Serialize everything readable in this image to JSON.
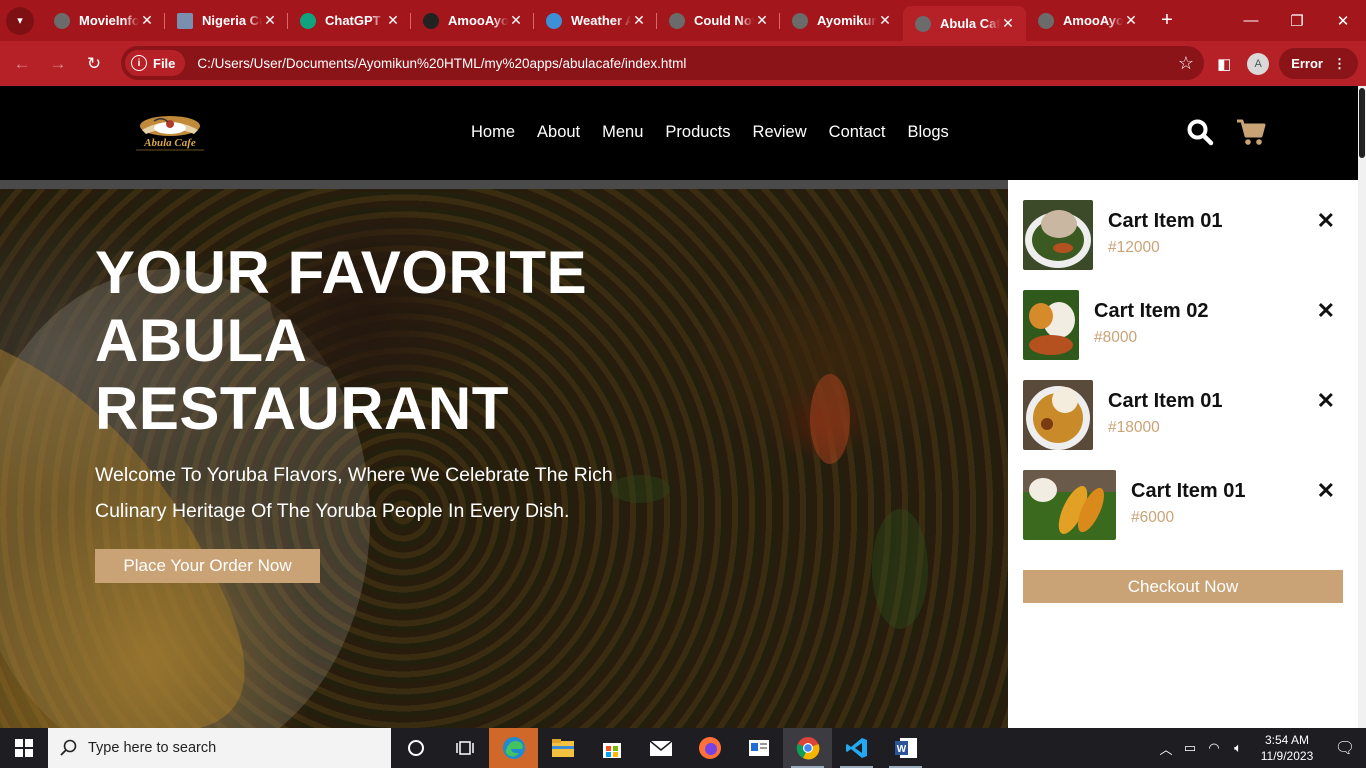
{
  "browser": {
    "tabs": [
      {
        "title": "MovieInfo"
      },
      {
        "title": "Nigeria Cuisine"
      },
      {
        "title": "ChatGPT"
      },
      {
        "title": "AmooAyomikun"
      },
      {
        "title": "Weather App"
      },
      {
        "title": "Could Not"
      },
      {
        "title": "Ayomikun"
      },
      {
        "title": "Abula Cafe",
        "active": true
      },
      {
        "title": "AmooAyomikun"
      }
    ],
    "new_tab": "+",
    "chip_label": "File",
    "url": "C:/Users/User/Documents/Ayomikun%20HTML/my%20apps/abulacafe/index.html",
    "profile_initial": "A",
    "error_label": "Error"
  },
  "site": {
    "logo_text": "Abula Cafe",
    "nav": [
      "Home",
      "About",
      "Menu",
      "Products",
      "Review",
      "Contact",
      "Blogs"
    ],
    "hero": {
      "title": "YOUR FAVORITE ABULA RESTAURANT",
      "subtitle": "Welcome To Yoruba Flavors, Where We Celebrate The Rich Culinary Heritage Of The Yoruba People In Every Dish.",
      "cta": "Place Your Order Now"
    },
    "cart": {
      "items": [
        {
          "name": "Cart Item 01",
          "price": "#12000"
        },
        {
          "name": "Cart Item 02",
          "price": "#8000"
        },
        {
          "name": "Cart Item 01",
          "price": "#18000"
        },
        {
          "name": "Cart Item 01",
          "price": "#6000"
        }
      ],
      "checkout": "Checkout Now"
    },
    "colors": {
      "accent": "#c9a376",
      "browser": "#b52127"
    }
  },
  "taskbar": {
    "search_placeholder": "Type here to search",
    "time": "3:54 AM",
    "date": "11/9/2023"
  }
}
